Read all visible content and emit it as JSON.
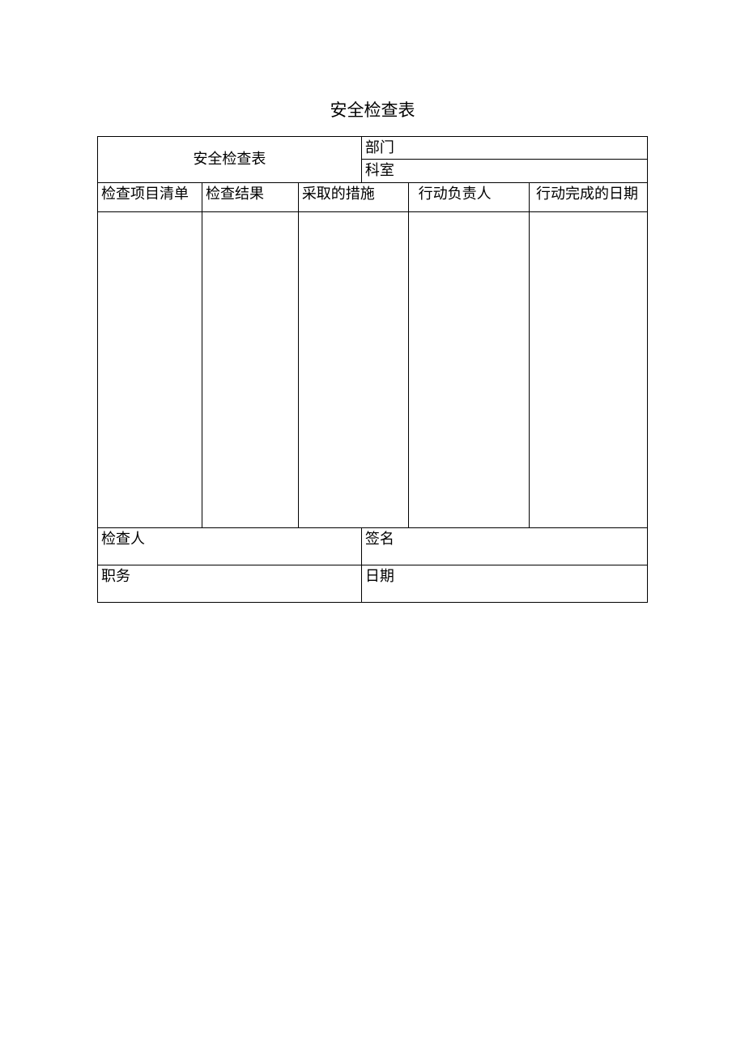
{
  "title": "安全检查表",
  "header": {
    "form_name": "安全检查表",
    "dept_label": "部门",
    "section_label": "科室"
  },
  "columns": {
    "c1": "检查项目清单",
    "c2": "检查结果",
    "c3": "采取的措施",
    "c4": "行动负责人",
    "c5": "行动完成的日期"
  },
  "footer": {
    "inspector": "检查人",
    "signature": "签名",
    "position": "职务",
    "date": "日期"
  }
}
